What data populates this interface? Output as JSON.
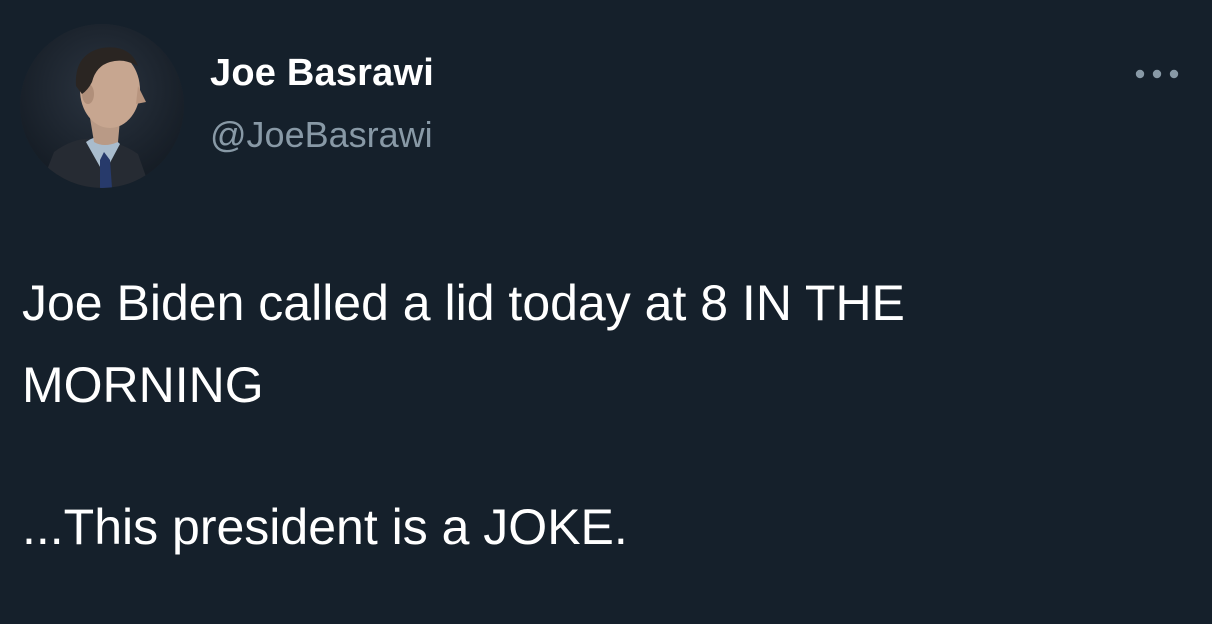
{
  "author": {
    "display_name": "Joe Basrawi",
    "handle": "@JoeBasrawi",
    "avatar_icon": "profile-photo-icon"
  },
  "tweet": {
    "paragraph_1": "Joe Biden called a lid today at 8 IN THE\nMORNING",
    "paragraph_2": "...This president is a JOKE."
  },
  "actions": {
    "more_icon": "more-options-icon"
  },
  "colors": {
    "background": "#15202b",
    "primary_text": "#ffffff",
    "secondary_text": "#8899a6"
  }
}
